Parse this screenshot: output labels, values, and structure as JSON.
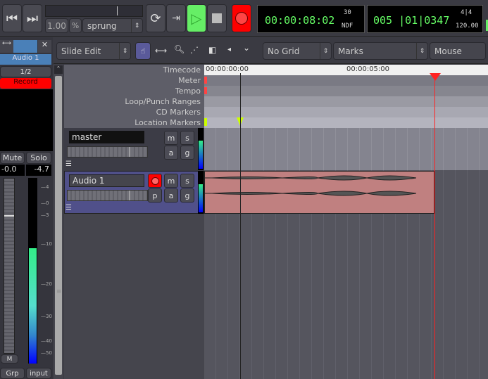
{
  "transport": {
    "shuttle_speed": "1.00",
    "shuttle_unit": "%",
    "shuttle_mode": "sprung"
  },
  "clocks": {
    "primary": {
      "value": "00:00:08:02",
      "fps": "30",
      "mode": "NDF"
    },
    "secondary": {
      "value": "005 |01|0347",
      "meter": "4|4",
      "tempo": "120.00"
    }
  },
  "toolbar": {
    "edit_mode": "Slide Edit",
    "grid": "No Grid",
    "snap_to": "Marks",
    "edit_point": "Mouse"
  },
  "strip": {
    "name": "Audio 1",
    "input_button": "1/2",
    "record_label": "Record",
    "mute": "Mute",
    "solo": "Solo",
    "gain": "-0.0",
    "peak": "-4.7",
    "meter_ticks": [
      "4",
      "0",
      "3",
      "10",
      "20",
      "30",
      "40",
      "50"
    ],
    "m_button": "M",
    "group_button": "Grp",
    "input_label": "input",
    "meter_level": 0.62
  },
  "rulers": {
    "labels": [
      "Timecode",
      "Meter",
      "Tempo",
      "Loop/Punch Ranges",
      "CD Markers",
      "Location Markers"
    ],
    "timecode_ticks": [
      "00:00:00:00",
      "00:00:05:00"
    ]
  },
  "tracks": [
    {
      "name": "master",
      "buttons": [
        "m",
        "s",
        "a",
        "g"
      ]
    },
    {
      "name": "Audio 1",
      "buttons": [
        "m",
        "s",
        "p",
        "a",
        "g"
      ]
    }
  ],
  "colors": {
    "record": "#ff0000",
    "play": "#66ee66",
    "region": "#c08080",
    "playhead": "#ff2020"
  }
}
